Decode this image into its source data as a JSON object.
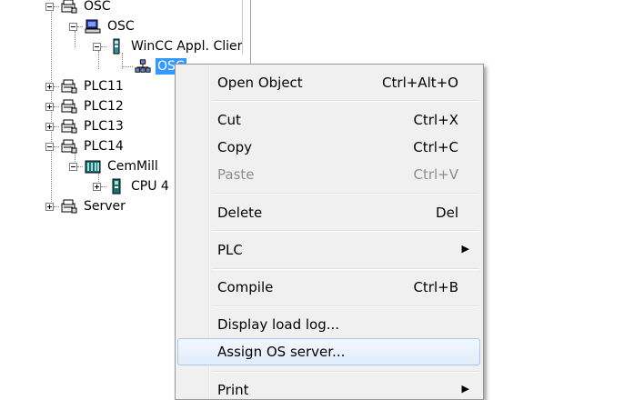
{
  "tree": {
    "nodes": [
      {
        "label": "OSC",
        "icon": "project-icon"
      },
      {
        "label": "OSC",
        "icon": "computer-icon"
      },
      {
        "label": "WinCC Appl. Clier",
        "icon": "application-icon"
      },
      {
        "label": "OSC",
        "icon": "network-icon",
        "selected": true
      },
      {
        "label": "PLC11",
        "icon": "project-icon"
      },
      {
        "label": "PLC12",
        "icon": "project-icon"
      },
      {
        "label": "PLC13",
        "icon": "project-icon"
      },
      {
        "label": "PLC14",
        "icon": "project-icon"
      },
      {
        "label": "CemMill",
        "icon": "station-icon"
      },
      {
        "label": "CPU 4",
        "icon": "cpu-icon"
      },
      {
        "label": "Server",
        "icon": "project-icon"
      }
    ]
  },
  "menu": {
    "items": [
      {
        "label": "Open Object",
        "shortcut": "Ctrl+Alt+O"
      },
      {
        "label": "Cut",
        "shortcut": "Ctrl+X"
      },
      {
        "label": "Copy",
        "shortcut": "Ctrl+C"
      },
      {
        "label": "Paste",
        "shortcut": "Ctrl+V",
        "disabled": true
      },
      {
        "label": "Delete",
        "shortcut": "Del"
      },
      {
        "label": "PLC",
        "shortcut": ""
      },
      {
        "label": "Compile",
        "shortcut": "Ctrl+B"
      },
      {
        "label": "Display load log...",
        "shortcut": ""
      },
      {
        "label": "Assign OS server...",
        "shortcut": "",
        "highlighted": true
      },
      {
        "label": "Print",
        "shortcut": ""
      }
    ],
    "submenu_arrow": "▶"
  },
  "colors": {
    "selection": "#3399ff",
    "menu_background": "#f0f0f0",
    "menu_highlight_border": "#a8c8ee",
    "disabled_text": "#8d8d8d"
  }
}
